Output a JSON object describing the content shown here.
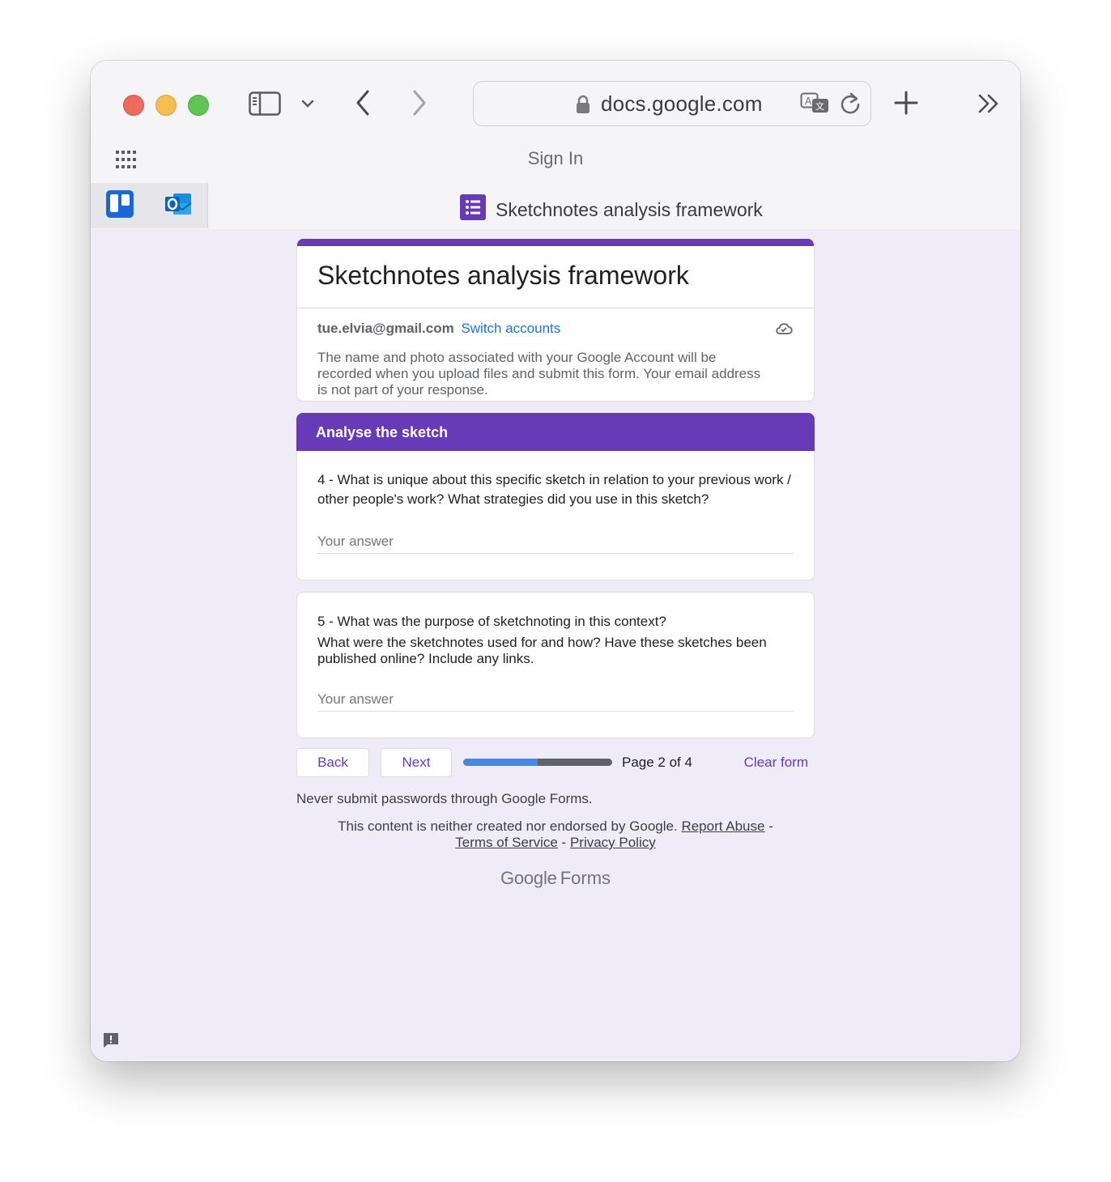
{
  "browser": {
    "url": "docs.google.com",
    "page_title": "Sign In",
    "tab_title": "Sketchnotes analysis framework",
    "pinned_tabs": [
      "trello-icon",
      "outlook-icon"
    ]
  },
  "form": {
    "title": "Sketchnotes analysis framework",
    "account_email": "tue.elvia@gmail.com",
    "switch_accounts": "Switch accounts",
    "notice": "The name and photo associated with your Google Account will be recorded when you upload files and submit this form. Your email address is not part of your response.",
    "section_title": "Analyse the sketch",
    "questions": [
      {
        "text": "4 - What is unique about this specific sketch in relation to your previous work / other people's work? What strategies did you use in this sketch?",
        "placeholder": "Your answer"
      },
      {
        "text": "5 - What was the purpose of sketchnoting in this context?",
        "subtext": "What were the sketchnotes used for and how? Have these sketches been published online? Include any links.",
        "placeholder": "Your answer"
      }
    ],
    "nav": {
      "back": "Back",
      "next": "Next",
      "page_label": "Page 2 of 4",
      "progress": 0.5,
      "clear": "Clear form"
    },
    "password_warning": "Never submit passwords through Google Forms.",
    "disclaimer": {
      "text": "This content is neither created nor endorsed by Google.",
      "report_abuse": "Report Abuse",
      "terms": "Terms of Service",
      "privacy": "Privacy Policy",
      "sep": " - "
    },
    "brand_google": "Google",
    "brand_forms": "Forms"
  },
  "colors": {
    "accent": "#673ab7",
    "link": "#1a73e8",
    "progress": "#4a86e8"
  }
}
